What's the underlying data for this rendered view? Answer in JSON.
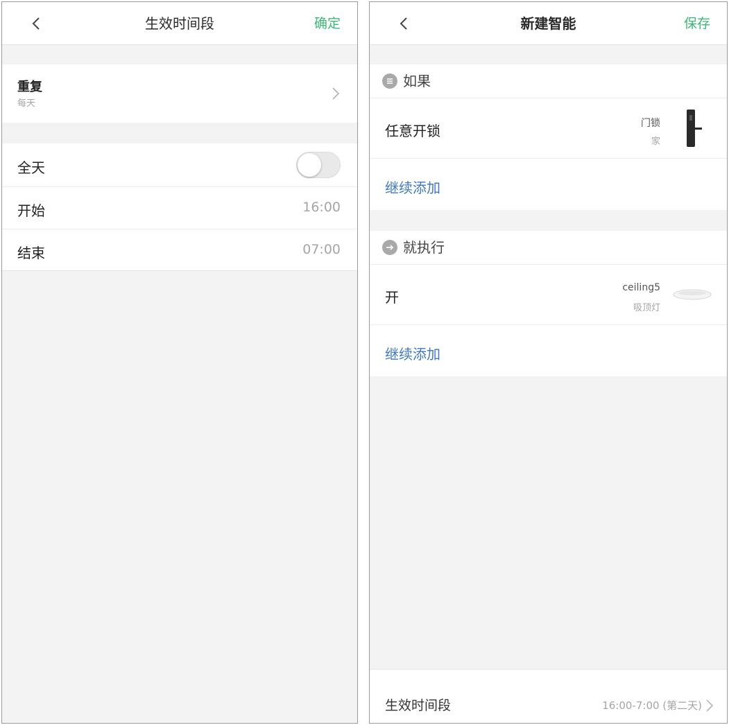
{
  "left_screen": {
    "nav": {
      "title": "生效时间段",
      "confirm_label": "确定",
      "back_icon": "chevron-left-icon"
    },
    "repeat": {
      "label": "重复",
      "value": "每天",
      "chevron_icon": "chevron-right-icon"
    },
    "all_day": {
      "label": "全天",
      "toggle_on": false
    },
    "start": {
      "label": "开始",
      "value": "16:00"
    },
    "end": {
      "label": "结束",
      "value": "07:00"
    }
  },
  "right_screen": {
    "nav": {
      "title": "新建智能",
      "save_label": "保存",
      "back_icon": "chevron-left-icon"
    },
    "if_section": {
      "header": "如果",
      "icon": "list-icon",
      "condition": {
        "label": "任意开锁",
        "device_name": "门锁",
        "device_room": "家",
        "device_icon": "door-lock-icon"
      },
      "add_more": "继续添加"
    },
    "then_section": {
      "header": "就执行",
      "icon": "arrow-right-circle-icon",
      "action": {
        "label": "开",
        "device_name": "ceiling5",
        "device_type": "吸顶灯",
        "device_icon": "ceiling-light-icon"
      },
      "add_more": "继续添加"
    },
    "time_period": {
      "label": "生效时间段",
      "value": "16:00-7:00 (第二天)",
      "chevron_icon": "chevron-right-icon"
    }
  },
  "colors": {
    "accent_green": "#3bb877",
    "link_blue": "#3f79c2",
    "background": "#f3f3f3"
  }
}
